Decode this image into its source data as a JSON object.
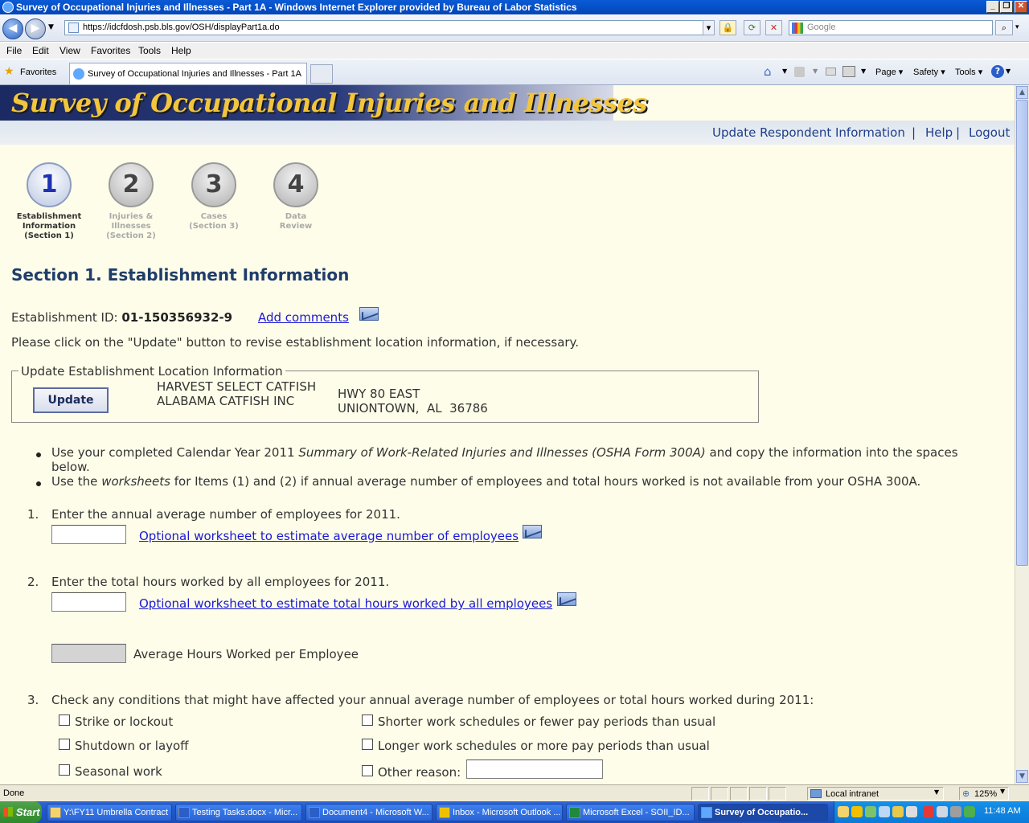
{
  "window": {
    "title": "Survey of Occupational Injuries and Illnesses - Part 1A - Windows Internet Explorer provided by Bureau of Labor Statistics",
    "minimize": "_",
    "restore": "❐",
    "close": "✕"
  },
  "browser": {
    "url": "https://idcfdosh.psb.bls.gov/OSH/displayPart1a.do",
    "search_placeholder": "Google",
    "menu": [
      "File",
      "Edit",
      "View",
      "Favorites",
      "Tools",
      "Help"
    ],
    "favorites_label": "Favorites",
    "tab_title": "Survey of Occupational Injuries and Illnesses - Part 1A",
    "toolbar": {
      "page": "Page",
      "safety": "Safety",
      "tools": "Tools"
    }
  },
  "page": {
    "banner_title": "Survey of Occupational Injuries and Illnesses",
    "links": {
      "update": "Update Respondent Information",
      "sep": "|",
      "help": "Help",
      "sep2": "|",
      "logout": "Logout"
    },
    "steps": [
      {
        "num": "1",
        "label": "Establishment\nInformation\n(Section 1)",
        "active": true
      },
      {
        "num": "2",
        "label": "Injuries &\nIllnesses\n(Section 2)",
        "active": false
      },
      {
        "num": "3",
        "label": "Cases\n(Section 3)",
        "active": false
      },
      {
        "num": "4",
        "label": "Data\nReview",
        "active": false
      }
    ],
    "section_title": "Section 1. Establishment Information",
    "estab_label": "Establishment ID: ",
    "estab_id": "01-150356932-9",
    "add_comments": "Add comments ",
    "instruction": "Please click on the \"Update\" button to revise establishment location information, if necessary.",
    "location": {
      "legend": "Update Establishment Location Information",
      "update_button": "Update",
      "name1": "HARVEST SELECT CATFISH",
      "name2": "ALABAMA CATFISH INC",
      "address1": "HWY 80 EAST",
      "address2": "UNIONTOWN,  AL  36786"
    },
    "bullet1_a": "Use your completed Calendar Year 2011 ",
    "bullet1_b": "Summary of Work-Related Injuries and Illnesses (OSHA Form 300A)",
    "bullet1_c": " and copy the information into the spaces",
    "bullet1_d": "below.",
    "bullet2_a": "Use the ",
    "bullet2_b": "worksheets",
    "bullet2_c": " for Items (1) and (2) if annual average number of employees and total hours worked is not available from your OSHA 300A.",
    "q1_num": "1.",
    "q1": "Enter the annual average number of employees for 2011.",
    "q1_link": "Optional worksheet to estimate average number of employees",
    "q1_value": "",
    "q2_num": "2.",
    "q2": "Enter the total hours worked by all employees for 2011.",
    "q2_link": "Optional worksheet to estimate total hours worked by all employees",
    "q2_value": "",
    "avg_label": "Average Hours Worked per Employee",
    "q3_num": "3.",
    "q3": "Check any conditions that might have affected your annual average number of employees or total hours worked during 2011:",
    "conditions": {
      "strike": "Strike or lockout",
      "shutdown": "Shutdown or layoff",
      "seasonal": "Seasonal work",
      "shorter": "Shorter work schedules or fewer pay periods than usual",
      "longer": "Longer work schedules or more pay periods than usual",
      "other": "Other reason:"
    }
  },
  "status": {
    "text": "Done",
    "zone": "Local intranet",
    "zoom": "125%"
  },
  "taskbar": {
    "start": "Start",
    "tasks": [
      "Y:\\FY11 Umbrella Contract",
      "Testing Tasks.docx - Micr...",
      "Document4 - Microsoft W...",
      "Inbox - Microsoft Outlook ...",
      "Microsoft Excel - SOII_ID...",
      "Survey of Occupatio..."
    ],
    "clock": "11:48 AM"
  }
}
